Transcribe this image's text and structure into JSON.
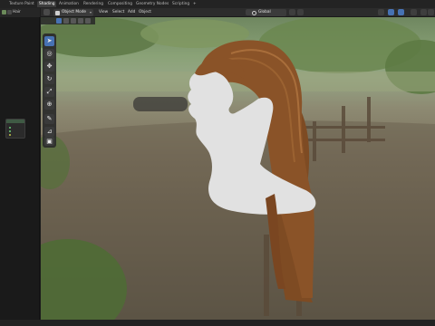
{
  "workspace_tabs": [
    {
      "label": "Texture Paint",
      "active": false
    },
    {
      "label": "Shading",
      "active": true
    },
    {
      "label": "Animation",
      "active": false
    },
    {
      "label": "Rendering",
      "active": false
    },
    {
      "label": "Compositing",
      "active": false
    },
    {
      "label": "Geometry Nodes",
      "active": false
    },
    {
      "label": "Scripting",
      "active": false
    },
    {
      "label": "+",
      "active": false
    }
  ],
  "left_panel": {
    "header_name": "Hair"
  },
  "viewport_header": {
    "mode": "Object Mode",
    "menus": [
      "View",
      "Select",
      "Add",
      "Object"
    ],
    "orientation": "Global"
  },
  "toolbar": {
    "tools": [
      {
        "icon": "select-cursor-icon",
        "active": true
      },
      {
        "icon": "cursor-icon",
        "active": false
      },
      {
        "icon": "move-icon",
        "active": false
      },
      {
        "icon": "rotate-icon",
        "active": false
      },
      {
        "icon": "scale-icon",
        "active": false
      },
      {
        "icon": "transform-icon",
        "active": false
      },
      {
        "icon": "annotate-icon",
        "active": false
      },
      {
        "icon": "measure-icon",
        "active": false
      },
      {
        "icon": "add-cube-icon",
        "active": false
      }
    ]
  },
  "colors": {
    "accent": "#4772b3",
    "ui_dark": "#1d1d1d",
    "header": "#2c2c2c",
    "hair": "#8a5328",
    "bust": "#e1e1e1"
  }
}
